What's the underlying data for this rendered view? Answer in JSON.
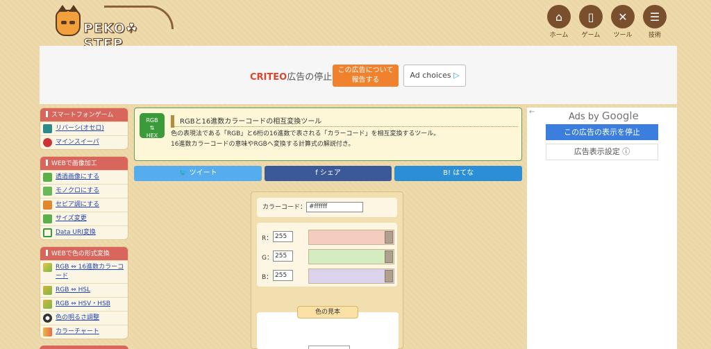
{
  "header": {
    "logo_text": "PEKO☘STEP",
    "nav": [
      {
        "label": "ホーム",
        "icon": "home-icon",
        "glyph": "⌂"
      },
      {
        "label": "ゲーム",
        "icon": "smartphone-icon",
        "glyph": "▯"
      },
      {
        "label": "ツール",
        "icon": "tools-icon",
        "glyph": "✕"
      },
      {
        "label": "技術",
        "icon": "document-icon",
        "glyph": "☰"
      }
    ]
  },
  "ad_banner": {
    "criteo_brand": "CRITEO",
    "criteo_text": "広告の停止",
    "stop_button_line1": "この広告について",
    "stop_button_line2": "報告する",
    "ad_choices": "Ad choices",
    "ad_choices_glyph": "▷"
  },
  "sidebar": {
    "sections": [
      {
        "title": "スマートフォンゲーム",
        "items": [
          {
            "label": "リバーシ(オセロ)",
            "icon": "reversi-icon",
            "color": "#2c8a8a"
          },
          {
            "label": "マインスイーパ",
            "icon": "mine-icon",
            "color": "#cc3333"
          }
        ]
      },
      {
        "title": "WEBで画像加工",
        "items": [
          {
            "label": "透過画像にする",
            "icon": "cube-green-icon",
            "color": "#5bb04a"
          },
          {
            "label": "モノクロにする",
            "icon": "cube-green-icon",
            "color": "#6ab85a"
          },
          {
            "label": "セピア調にする",
            "icon": "cube-orange-icon",
            "color": "#e0882e"
          },
          {
            "label": "サイズ変更",
            "icon": "cube-green-icon",
            "color": "#5bb04a"
          },
          {
            "label": "Data URI変換",
            "icon": "data-uri-icon",
            "color": "#3a9a3a"
          }
        ]
      },
      {
        "title": "WEBで色の形式変換",
        "items": [
          {
            "label": "RGB ⇔ 16進数カラーコード",
            "icon": "color-cube-icon",
            "color": "#d8b23a"
          },
          {
            "label": "RGB ⇔ HSL",
            "icon": "color-cube-icon",
            "color": "#c8a83a"
          },
          {
            "label": "RGB ⇔ HSV・HSB",
            "icon": "color-cube-icon",
            "color": "#c8a83a"
          },
          {
            "label": "色の明るさ調整",
            "icon": "brightness-icon",
            "color": "#333333"
          },
          {
            "label": "カラーチャート",
            "icon": "color-chart-icon",
            "color": "#e8b84a"
          }
        ]
      }
    ]
  },
  "intro": {
    "icon_line1": "RGB",
    "icon_line2": "⇅",
    "icon_line3": "HEX",
    "title": "RGBと16進数カラーコードの相互変換ツール",
    "text_line1": "色の表現法である「RGB」と6桁の16進数で表される「カラーコード」を相互変換するツール。",
    "text_line2": "16進数カラーコードの意味やRGBへ変換する計算式の解説付き。"
  },
  "share": {
    "twitter": "🐦 ツイート",
    "facebook": "f  シェア",
    "hatena": "B! はてな"
  },
  "tool": {
    "code_label": "カラーコード：",
    "code_value": "#ffffff",
    "rows": [
      {
        "label": "R：",
        "value": "255",
        "color": "#f4cdbf"
      },
      {
        "label": "G：",
        "value": "255",
        "color": "#d4ecc0"
      },
      {
        "label": "B：",
        "value": "255",
        "color": "#dcd4ec"
      }
    ],
    "sample_title": "色の見本",
    "sample_color": "#ffffff"
  },
  "right_ad": {
    "arrow": "←",
    "ads_by": "Ads by",
    "google": "Google",
    "stop_button": "この広告の表示を停止",
    "settings_button": "広告表示設定 ⓘ"
  }
}
